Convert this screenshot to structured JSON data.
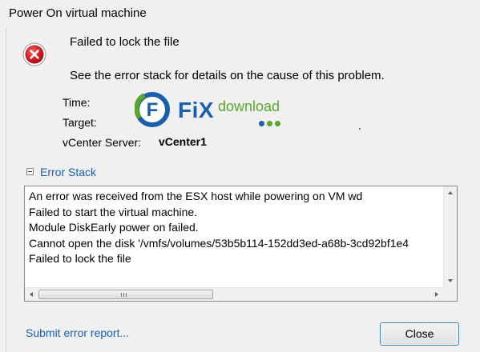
{
  "window": {
    "title": "Power On virtual machine"
  },
  "icons": {
    "error": "error-icon",
    "collapse": "collapse-minus-icon"
  },
  "message": {
    "main": "Failed to lock the file",
    "sub": "See the error stack for details on the cause of this problem."
  },
  "details": {
    "time_label": "Time:",
    "target_label": "Target:",
    "vcenter_label": "vCenter Server:",
    "vcenter_value": "vCenter1"
  },
  "watermark": {
    "letter": "F",
    "word": "FiX",
    "sub": "download"
  },
  "error_stack": {
    "toggle_label": "Error Stack",
    "lines": [
      "An error was received from the ESX host while powering on VM wd",
      "Failed to start the virtual machine.",
      "Module DiskEarly power on failed.",
      "Cannot open the disk '/vmfs/volumes/53b5b114-152dd3ed-a68b-3cd92bf1e4",
      "Failed to lock the file"
    ]
  },
  "footer": {
    "submit_link": "Submit error report...",
    "close_label": "Close"
  },
  "colors": {
    "link": "#1a5fb4",
    "error_red": "#c8151b",
    "button_border": "#3c7fb1"
  }
}
